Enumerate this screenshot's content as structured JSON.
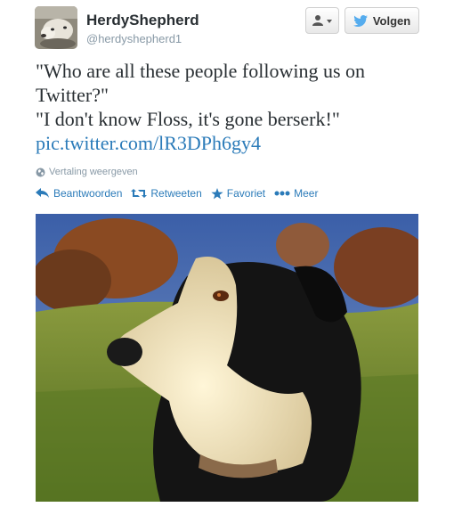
{
  "user": {
    "fullname": "HerdyShepherd",
    "username": "@herdyshepherd1"
  },
  "buttons": {
    "follow_label": "Volgen"
  },
  "tweet": {
    "line1": "\"Who are all these people following us on Twitter?\"",
    "line2": "\"I don't know Floss, it's gone berserk!\"",
    "link": "pic.twitter.com/lR3DPh6gy4"
  },
  "translate_label": "Vertaling weergeven",
  "actions": {
    "reply": "Beantwoorden",
    "retweet": "Retweeten",
    "favorite": "Favoriet",
    "more": "Meer"
  },
  "colors": {
    "link": "#2b7bb9",
    "meta": "#8899a6",
    "twitter_bird": "#55acee"
  },
  "icons": [
    "user-icon",
    "caret-down-icon",
    "twitter-bird-icon",
    "globe-icon",
    "reply-icon",
    "retweet-icon",
    "star-icon",
    "more-icon"
  ]
}
